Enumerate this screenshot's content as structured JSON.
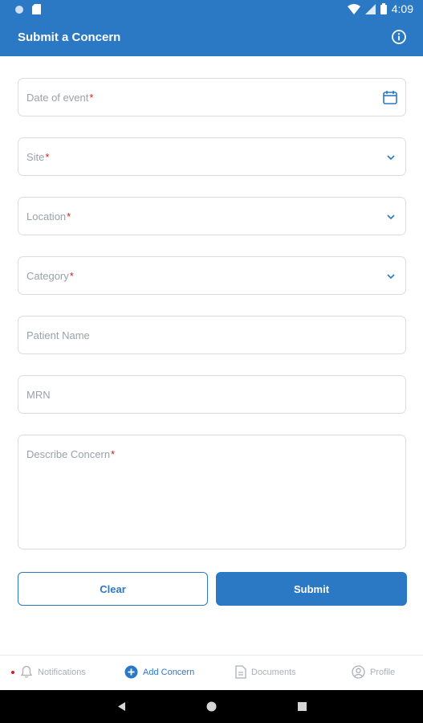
{
  "status_bar": {
    "time": "4:09"
  },
  "app_bar": {
    "title": "Submit a Concern"
  },
  "form": {
    "date_label": "Date of event",
    "site_label": "Site",
    "location_label": "Location",
    "category_label": "Category",
    "patient_label": "Patient Name",
    "mrn_label": "MRN",
    "describe_label": "Describe Concern",
    "required_mark": "*"
  },
  "buttons": {
    "clear": "Clear",
    "submit": "Submit"
  },
  "bottom_nav": {
    "notifications": "Notifications",
    "add_concern": "Add Concern",
    "documents": "Documents",
    "profile": "Profile"
  },
  "colors": {
    "primary": "#2b78c5",
    "required": "#d21f1f"
  }
}
